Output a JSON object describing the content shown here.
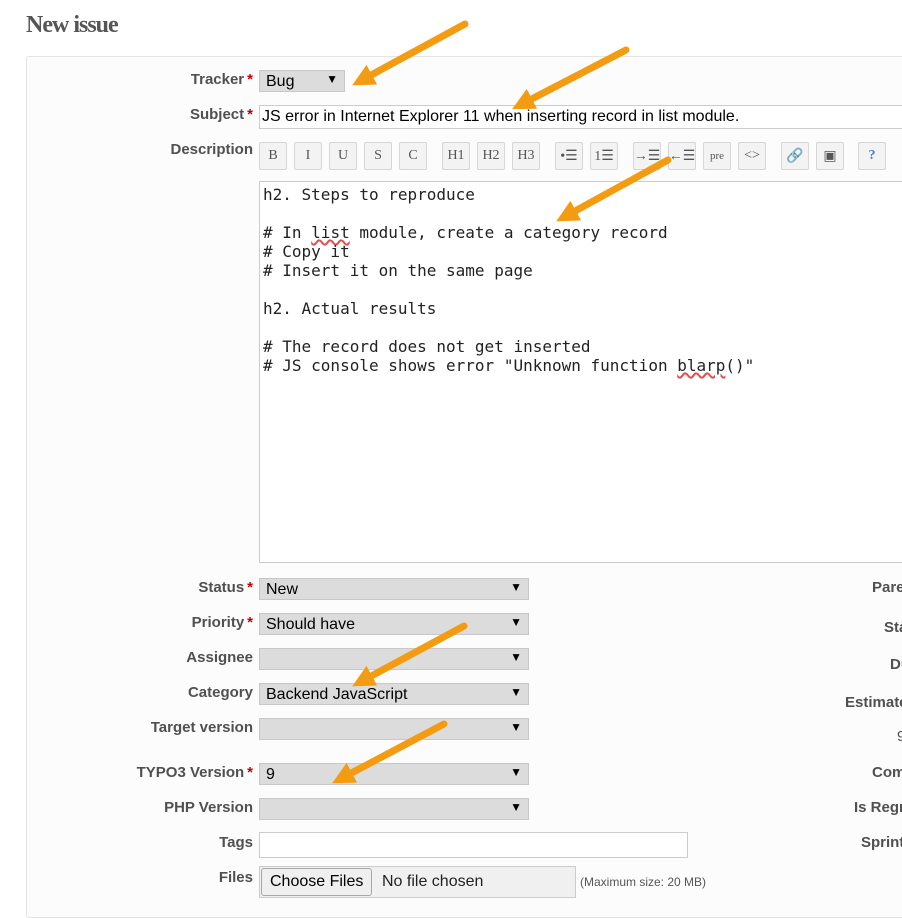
{
  "page": {
    "title": "New issue"
  },
  "form": {
    "tracker": {
      "label": "Tracker",
      "value": "Bug"
    },
    "subject": {
      "label": "Subject",
      "value": "JS error in Internet Explorer 11 when inserting record in list module."
    },
    "description": {
      "label": "Description",
      "toolbar": [
        {
          "name": "bold-icon",
          "glyph": "B"
        },
        {
          "name": "italic-icon",
          "glyph": "I"
        },
        {
          "name": "underline-icon",
          "glyph": "U"
        },
        {
          "name": "strikethrough-icon",
          "glyph": "S"
        },
        {
          "name": "inline-code-icon",
          "glyph": "C"
        },
        {
          "name": "heading1-icon",
          "glyph": "H1"
        },
        {
          "name": "heading2-icon",
          "glyph": "H2"
        },
        {
          "name": "heading3-icon",
          "glyph": "H3"
        },
        {
          "name": "bulleted-list-icon",
          "glyph": "•☰"
        },
        {
          "name": "numbered-list-icon",
          "glyph": "1☰"
        },
        {
          "name": "indent-icon",
          "glyph": "→☰"
        },
        {
          "name": "outdent-icon",
          "glyph": "←☰"
        },
        {
          "name": "preformatted-icon",
          "glyph": "pre"
        },
        {
          "name": "code-highlight-icon",
          "glyph": "<>"
        },
        {
          "name": "link-icon",
          "glyph": "🔗"
        },
        {
          "name": "image-icon",
          "glyph": "▣"
        },
        {
          "name": "help-icon",
          "glyph": "?"
        }
      ],
      "lines": [
        "h2. Steps to reproduce",
        "",
        "# In list module, create a category record",
        "# Copy it",
        "# Insert it on the same page",
        "",
        "h2. Actual results",
        "",
        "# The record does not get inserted",
        "# JS console shows error \"Unknown function blarp()\""
      ]
    },
    "status": {
      "label": "Status",
      "value": "New"
    },
    "priority": {
      "label": "Priority",
      "value": "Should have"
    },
    "assignee": {
      "label": "Assignee",
      "value": ""
    },
    "category": {
      "label": "Category",
      "value": "Backend JavaScript"
    },
    "target_version": {
      "label": "Target version",
      "value": ""
    },
    "typo3_version": {
      "label": "TYPO3 Version",
      "value": "9"
    },
    "php_version": {
      "label": "PHP Version",
      "value": ""
    },
    "tags": {
      "label": "Tags",
      "value": ""
    },
    "files": {
      "label": "Files",
      "button": "Choose Files",
      "status": "No file chosen",
      "hint": "(Maximum size: 20 MB)"
    }
  },
  "right_labels": [
    "Pare",
    "Sta",
    "Du",
    "Estimate",
    "9",
    "Com",
    "Is Regr",
    "Sprint"
  ],
  "colors": {
    "arrow": "#f39c12",
    "required": "#bb0000",
    "spellcheck": "#e05050"
  }
}
